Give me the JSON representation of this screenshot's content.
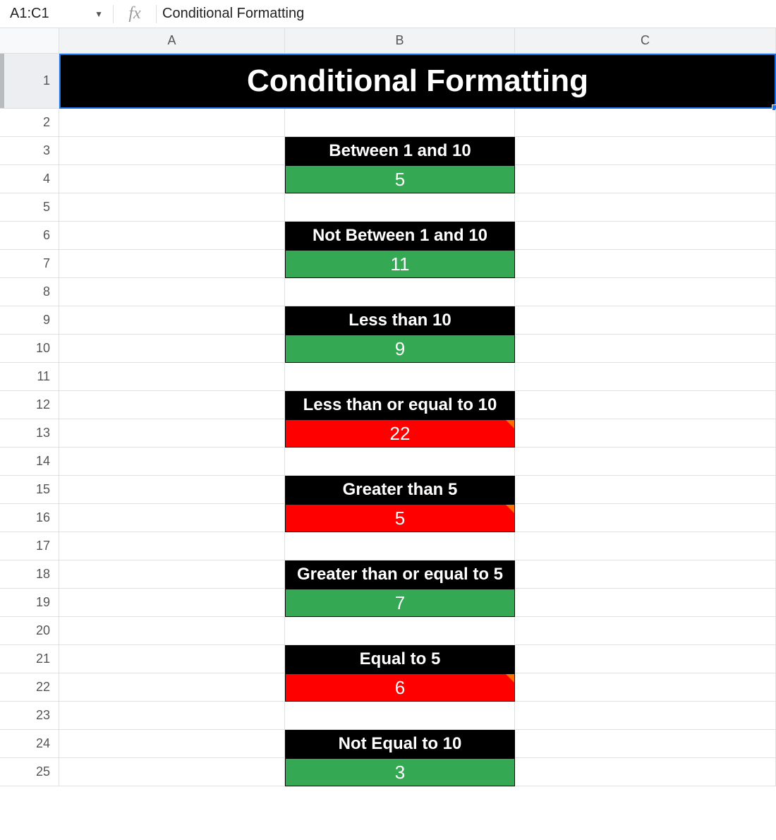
{
  "nameBox": "A1:C1",
  "fxLabel": "fx",
  "formulaValue": "Conditional Formatting",
  "columns": {
    "A": "A",
    "B": "B",
    "C": "C"
  },
  "rowNumbers": [
    "1",
    "2",
    "3",
    "4",
    "5",
    "6",
    "7",
    "8",
    "9",
    "10",
    "11",
    "12",
    "13",
    "14",
    "15",
    "16",
    "17",
    "18",
    "19",
    "20",
    "21",
    "22",
    "23",
    "24",
    "25"
  ],
  "title": "Conditional Formatting",
  "blocks": [
    {
      "label": "Between 1 and 10",
      "value": "5",
      "color": "green",
      "note": false
    },
    {
      "label": "Not Between 1 and 10",
      "value": "11",
      "color": "green",
      "note": false
    },
    {
      "label": "Less than 10",
      "value": "9",
      "color": "green",
      "note": false
    },
    {
      "label": "Less than or equal to 10",
      "value": "22",
      "color": "red",
      "note": true
    },
    {
      "label": "Greater than 5",
      "value": "5",
      "color": "red",
      "note": true
    },
    {
      "label": "Greater than or equal to 5",
      "value": "7",
      "color": "green",
      "note": false
    },
    {
      "label": "Equal to 5",
      "value": "6",
      "color": "red",
      "note": true
    },
    {
      "label": "Not Equal to 10",
      "value": "3",
      "color": "green",
      "note": false
    }
  ]
}
